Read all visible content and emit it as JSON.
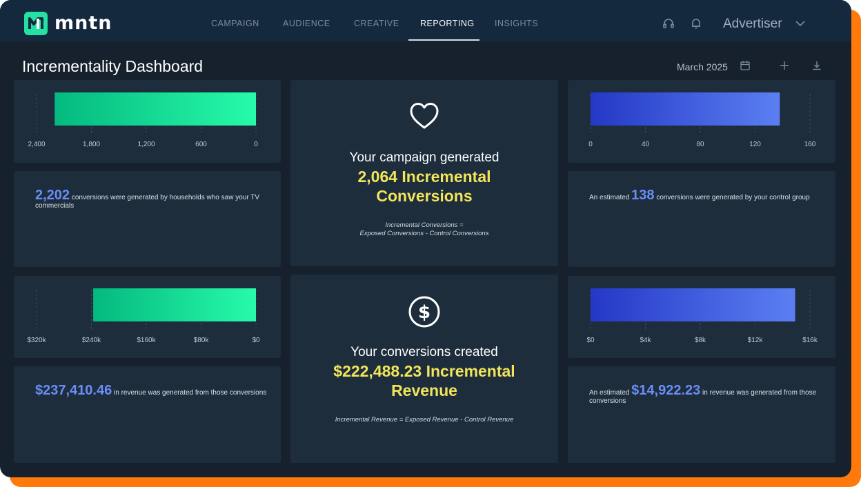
{
  "brand": {
    "name": "mntn",
    "accent": "#23e0a3"
  },
  "nav": {
    "items": [
      {
        "label": "CAMPAIGN"
      },
      {
        "label": "AUDIENCE"
      },
      {
        "label": "CREATIVE"
      },
      {
        "label": "REPORTING",
        "active": true
      },
      {
        "label": "INSIGHTS"
      }
    ],
    "icons": [
      "headset-icon",
      "bell-icon"
    ],
    "account_label": "Advertiser"
  },
  "header": {
    "title": "Incrementality Dashboard",
    "date": "March 2025",
    "icons": [
      "calendar-icon",
      "plus-icon",
      "download-icon"
    ]
  },
  "cards": {
    "exposed_conversions": {
      "value": "2,202",
      "text": "conversions were generated by households who saw your TV commercials"
    },
    "control_conversions": {
      "prefix": "An estimated",
      "value": "138",
      "text": "conversions were generated by your control group"
    },
    "exposed_revenue": {
      "value": "$237,410.46",
      "text": "in revenue was generated from those conversions"
    },
    "control_revenue": {
      "prefix": "An estimated",
      "value": "$14,922.23",
      "text": "in revenue was generated from those conversions"
    },
    "incremental_conversions": {
      "icon": "heart-icon",
      "line1": "Your campaign generated",
      "line2": "2,064 Incremental Conversions",
      "formula_line1": "Incremental Conversions =",
      "formula_line2": "Exposed Conversions - Control Conversions"
    },
    "incremental_revenue": {
      "icon": "dollar-icon",
      "line1": "Your conversions created",
      "line2": "$222,488.23 Incremental Revenue",
      "formula": "Incremental Revenue = Exposed Revenue - Control Revenue"
    }
  },
  "colors": {
    "exposed_gradient": [
      "#04b97f",
      "#27fba9"
    ],
    "control_gradient": [
      "#2438c6",
      "#5b7ff3"
    ],
    "highlight_number": "#6a8ef5",
    "incremental_text": "#f2e55a"
  },
  "chart_data": [
    {
      "type": "bar",
      "orientation": "horizontal",
      "direction": "reversed",
      "categories": [
        ""
      ],
      "values": [
        2202
      ],
      "xlim": [
        2400,
        0
      ],
      "ticks": [
        "2,400",
        "1,800",
        "1,200",
        "600",
        "0"
      ]
    },
    {
      "type": "bar",
      "orientation": "horizontal",
      "categories": [
        ""
      ],
      "values": [
        138
      ],
      "xlim": [
        0,
        160
      ],
      "ticks": [
        "0",
        "40",
        "80",
        "120",
        "160"
      ]
    },
    {
      "type": "bar",
      "orientation": "horizontal",
      "direction": "reversed",
      "categories": [
        ""
      ],
      "values": [
        237410.46
      ],
      "xlim": [
        320000,
        0
      ],
      "ticks": [
        "$320k",
        "$240k",
        "$160k",
        "$80k",
        "$0"
      ]
    },
    {
      "type": "bar",
      "orientation": "horizontal",
      "categories": [
        ""
      ],
      "values": [
        14922.23
      ],
      "xlim": [
        0,
        16000
      ],
      "ticks": [
        "$0",
        "$4k",
        "$8k",
        "$12k",
        "$16k"
      ]
    }
  ]
}
